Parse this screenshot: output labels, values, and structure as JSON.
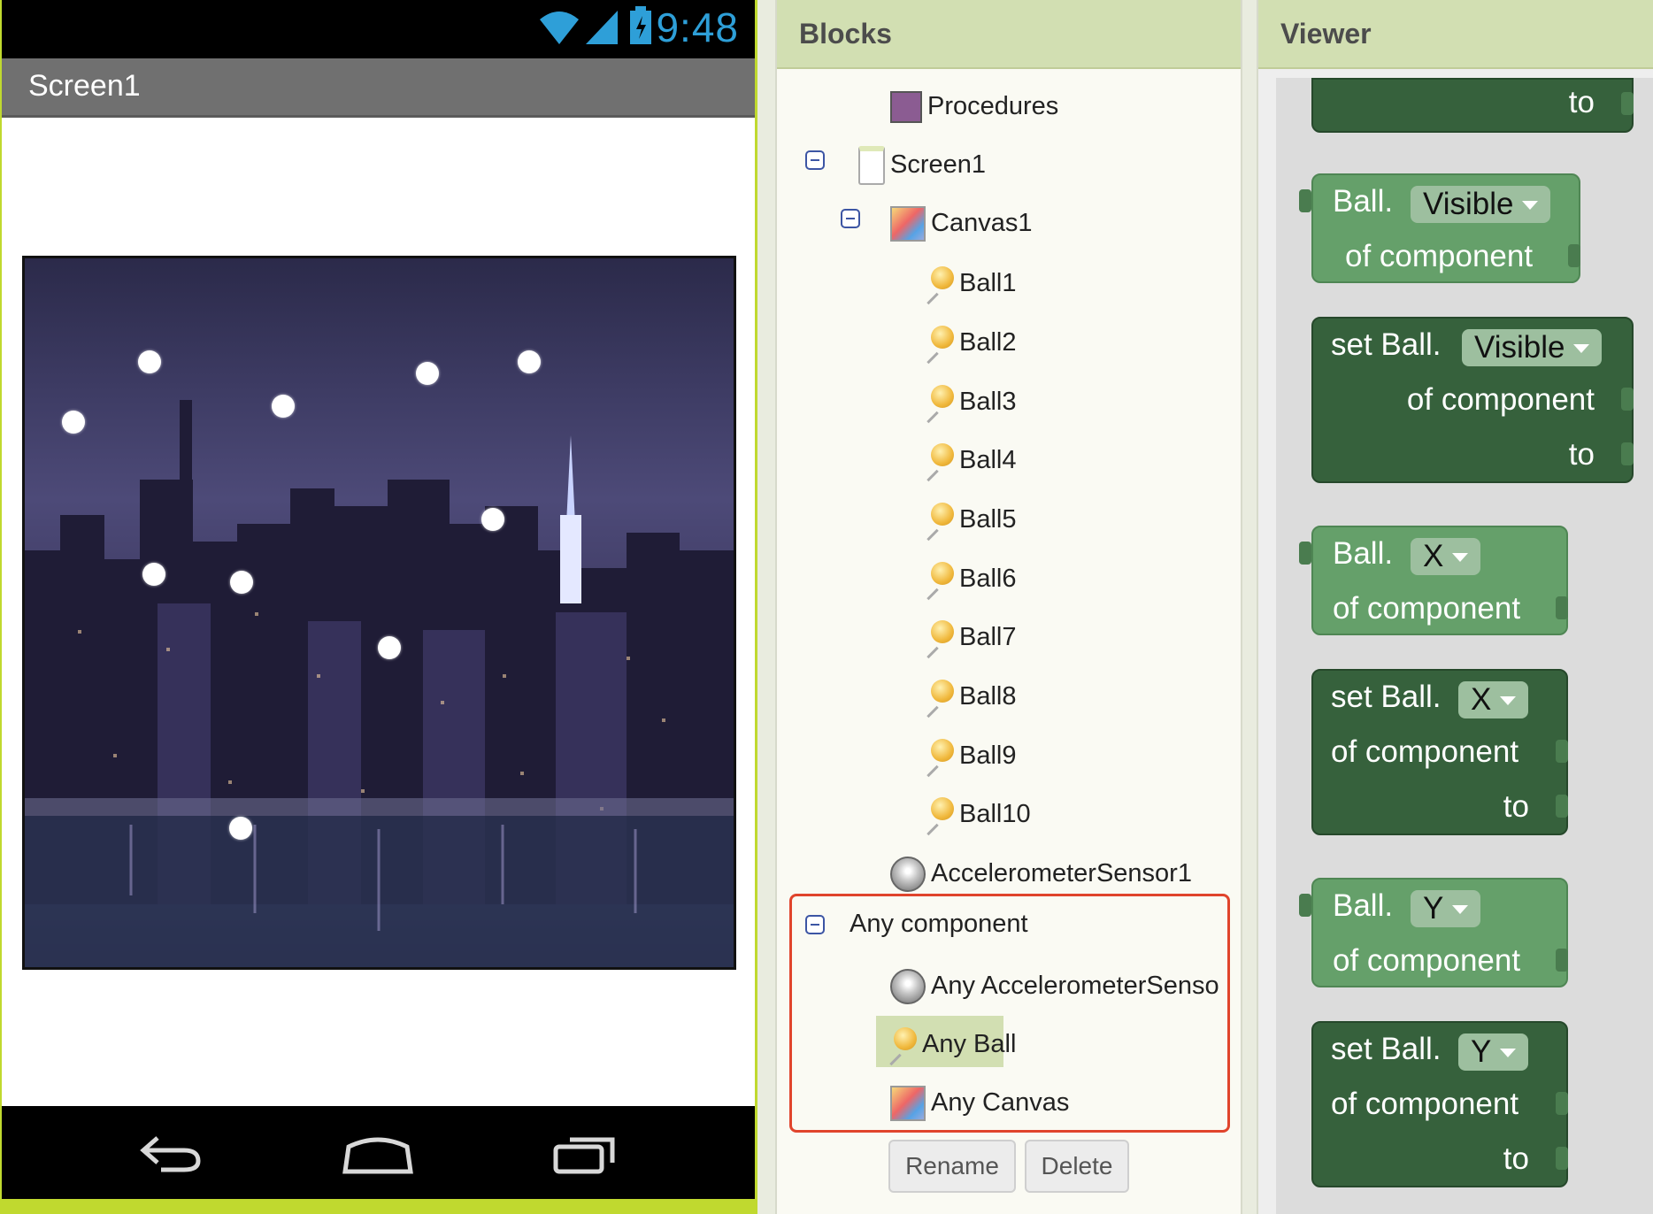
{
  "phone": {
    "status_time": "9:48",
    "screen_title": "Screen1"
  },
  "blocks_panel": {
    "title": "Blocks",
    "tree": {
      "procedures": "Procedures",
      "screen": "Screen1",
      "canvas": "Canvas1",
      "balls": [
        "Ball1",
        "Ball2",
        "Ball3",
        "Ball4",
        "Ball5",
        "Ball6",
        "Ball7",
        "Ball8",
        "Ball9",
        "Ball10"
      ],
      "accelerometer": "AccelerometerSensor1",
      "any_component": "Any component",
      "any_accelerometer": "Any AccelerometerSenso",
      "any_ball": "Any Ball",
      "any_canvas": "Any Canvas"
    },
    "rename_button": "Rename",
    "delete_button": "Delete"
  },
  "viewer_panel": {
    "title": "Viewer",
    "blocks": {
      "top_partial_to": "to",
      "get_visible": {
        "prefix": "Ball.",
        "prop": "Visible",
        "of": "of component"
      },
      "set_visible": {
        "prefix": "set Ball.",
        "prop": "Visible",
        "of": "of component",
        "to": "to"
      },
      "get_x": {
        "prefix": "Ball.",
        "prop": "X",
        "of": "of component"
      },
      "set_x": {
        "prefix": "set Ball.",
        "prop": "X",
        "of": "of component",
        "to": "to"
      },
      "get_y": {
        "prefix": "Ball.",
        "prop": "Y",
        "of": "of component"
      },
      "set_y": {
        "prefix": "set Ball.",
        "prop": "Y",
        "of": "of component",
        "to": "to"
      }
    }
  },
  "colors": {
    "accent_green": "#c0d92f",
    "header_green": "#d2dfb2",
    "highlight_red": "#e0442c",
    "block_light": "#65a06a",
    "block_dark": "#36613c"
  }
}
